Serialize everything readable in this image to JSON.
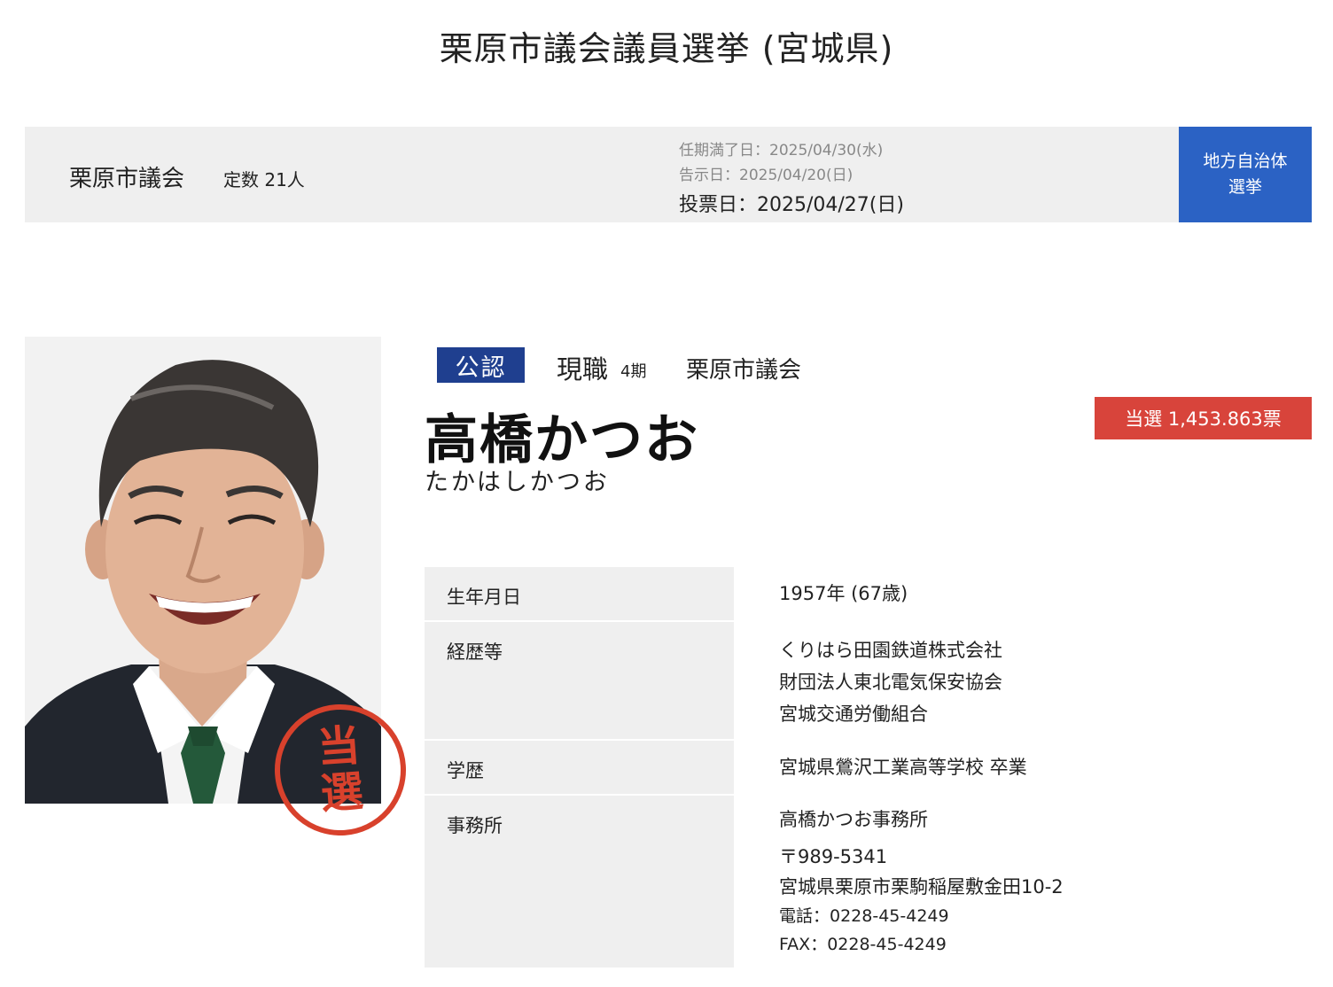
{
  "page": {
    "title": "栗原市議会議員選挙 (宮城県)"
  },
  "election": {
    "council": "栗原市議会",
    "seats": "定数 21人",
    "term_end": "任期満了日：2025/04/30(水)",
    "notice_date": "告示日：2025/04/20(日)",
    "vote_date": "投票日：2025/04/27(日)",
    "category": [
      "地方自治体",
      "選挙"
    ],
    "category_color": "#2b62c4"
  },
  "candidate": {
    "tag": "公認",
    "status": "現職",
    "terms": "4期",
    "council": "栗原市議会",
    "name": "高橋かつお",
    "kana": "たかはしかつお",
    "result": "当選 1,453.863票",
    "stamp": [
      "当",
      "選"
    ],
    "result_color": "#d8443b"
  },
  "profile": {
    "birth": {
      "label": "生年月日",
      "value": "1957年 (67歳)"
    },
    "career": {
      "label": "経歴等",
      "lines": [
        "くりはら田園鉄道株式会社",
        "財団法人東北電気保安協会",
        "宮城交通労働組合"
      ]
    },
    "education": {
      "label": "学歴",
      "value": "宮城県鶯沢工業高等学校 卒業"
    },
    "office": {
      "label": "事務所",
      "name": "高橋かつお事務所",
      "postal": "〒989-5341",
      "address": "宮城県栗原市栗駒稲屋敷金田10-2",
      "phone": "電話：0228-45-4249",
      "fax": "FAX：0228-45-4249"
    }
  }
}
